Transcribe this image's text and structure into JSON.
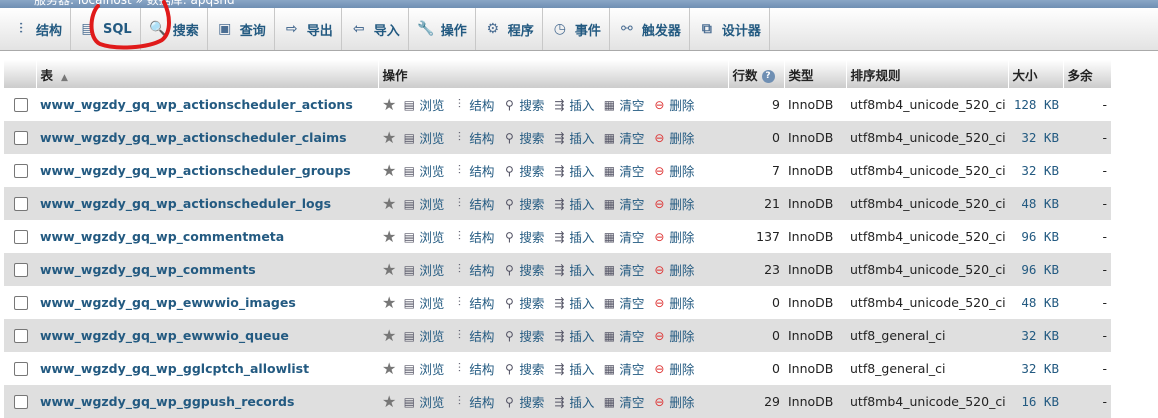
{
  "breadcrumb": {
    "text": "服务器: localhost » 数据库: apqshd"
  },
  "tabs": [
    {
      "label": "结构",
      "icon": "structure-icon",
      "glyph": "⫶"
    },
    {
      "label": "SQL",
      "icon": "sql-icon",
      "glyph": "▤"
    },
    {
      "label": "搜索",
      "icon": "search-icon",
      "glyph": "🔍"
    },
    {
      "label": "查询",
      "icon": "query-icon",
      "glyph": "▣"
    },
    {
      "label": "导出",
      "icon": "export-icon",
      "glyph": "⇨"
    },
    {
      "label": "导入",
      "icon": "import-icon",
      "glyph": "⇦"
    },
    {
      "label": "操作",
      "icon": "wrench-icon",
      "glyph": "🔧"
    },
    {
      "label": "程序",
      "icon": "gears-icon",
      "glyph": "⚙"
    },
    {
      "label": "事件",
      "icon": "clock-icon",
      "glyph": "◷"
    },
    {
      "label": "触发器",
      "icon": "trigger-icon",
      "glyph": "⚯"
    },
    {
      "label": "设计器",
      "icon": "designer-icon",
      "glyph": "⧉"
    }
  ],
  "columns": {
    "table": "表",
    "actions": "操作",
    "rows": "行数",
    "type": "类型",
    "collation": "排序规则",
    "size": "大小",
    "overhead": "多余"
  },
  "actions": {
    "browse": "浏览",
    "structure": "结构",
    "search": "搜索",
    "insert": "插入",
    "empty": "清空",
    "drop": "删除"
  },
  "rows": [
    {
      "name": "www_wgzdy_gq_wp_actionscheduler_actions",
      "rows": "9",
      "type": "InnoDB",
      "collation": "utf8mb4_unicode_520_ci",
      "size": "128 KB",
      "overhead": "-"
    },
    {
      "name": "www_wgzdy_gq_wp_actionscheduler_claims",
      "rows": "0",
      "type": "InnoDB",
      "collation": "utf8mb4_unicode_520_ci",
      "size": "32 KB",
      "overhead": "-"
    },
    {
      "name": "www_wgzdy_gq_wp_actionscheduler_groups",
      "rows": "7",
      "type": "InnoDB",
      "collation": "utf8mb4_unicode_520_ci",
      "size": "32 KB",
      "overhead": "-"
    },
    {
      "name": "www_wgzdy_gq_wp_actionscheduler_logs",
      "rows": "21",
      "type": "InnoDB",
      "collation": "utf8mb4_unicode_520_ci",
      "size": "48 KB",
      "overhead": "-"
    },
    {
      "name": "www_wgzdy_gq_wp_commentmeta",
      "rows": "137",
      "type": "InnoDB",
      "collation": "utf8mb4_unicode_520_ci",
      "size": "96 KB",
      "overhead": "-"
    },
    {
      "name": "www_wgzdy_gq_wp_comments",
      "rows": "23",
      "type": "InnoDB",
      "collation": "utf8mb4_unicode_520_ci",
      "size": "96 KB",
      "overhead": "-"
    },
    {
      "name": "www_wgzdy_gq_wp_ewwwio_images",
      "rows": "0",
      "type": "InnoDB",
      "collation": "utf8mb4_unicode_520_ci",
      "size": "48 KB",
      "overhead": "-"
    },
    {
      "name": "www_wgzdy_gq_wp_ewwwio_queue",
      "rows": "0",
      "type": "InnoDB",
      "collation": "utf8_general_ci",
      "size": "32 KB",
      "overhead": "-"
    },
    {
      "name": "www_wgzdy_gq_wp_gglcptch_allowlist",
      "rows": "0",
      "type": "InnoDB",
      "collation": "utf8_general_ci",
      "size": "32 KB",
      "overhead": "-"
    },
    {
      "name": "www_wgzdy_gq_wp_ggpush_records",
      "rows": "29",
      "type": "InnoDB",
      "collation": "utf8mb4_unicode_520_ci",
      "size": "16 KB",
      "overhead": "-"
    }
  ]
}
